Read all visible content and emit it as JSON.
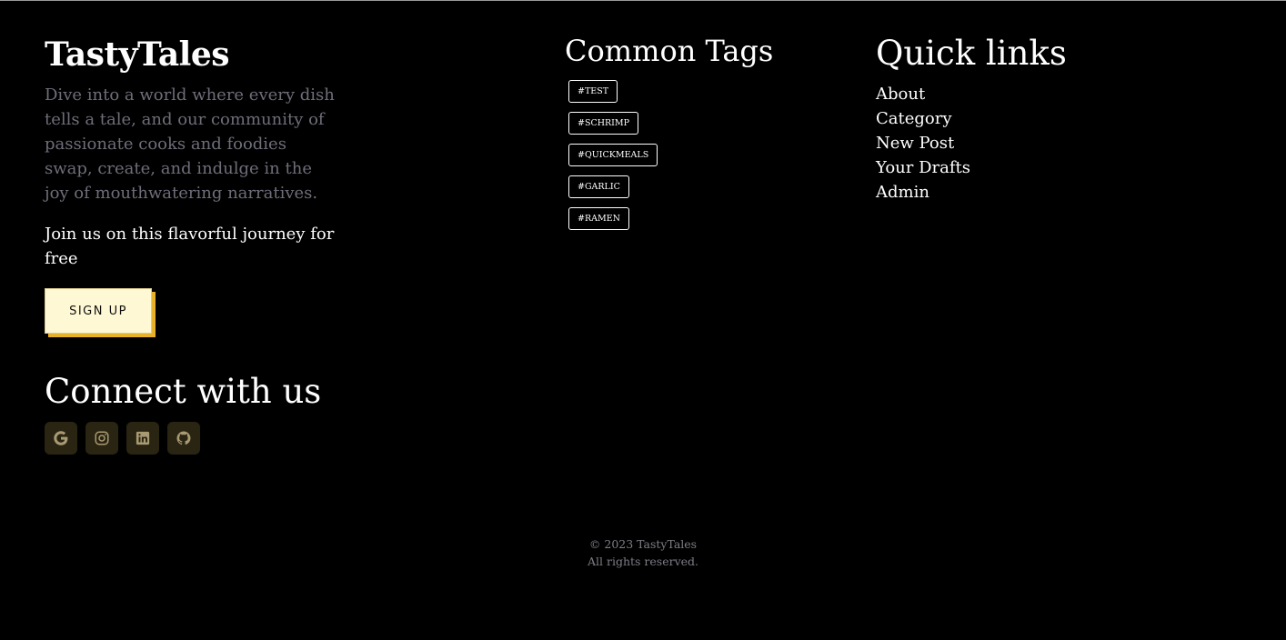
{
  "brand": {
    "name": "TastyTales",
    "tagline": "Dive into a world where every dish tells a tale, and our community of passionate cooks and foodies swap, create, and indulge in the joy of mouthwatering narratives.",
    "join_text": "Join us on this flavorful journey for free",
    "signup_label": "SIGN UP"
  },
  "connect": {
    "title": "Connect with us",
    "icons": [
      "google-icon",
      "instagram-icon",
      "linkedin-icon",
      "github-icon"
    ],
    "icon_color": "#a89a72",
    "icon_bg": "#2a2412"
  },
  "tags": {
    "title": "Common Tags",
    "items": [
      "#TEST",
      "#SCHRIMP",
      "#QUICKMEALS",
      "#GARLIC",
      "#RAMEN"
    ]
  },
  "quick_links": {
    "title": "Quick links",
    "items": [
      "About",
      "Category",
      "New Post",
      "Your Drafts",
      "Admin"
    ]
  },
  "footer": {
    "copyright": "© 2023 TastyTales",
    "rights": "All rights reserved."
  },
  "colors": {
    "background": "#000000",
    "accent": "#e8b12a",
    "button_bg": "#fff8d4",
    "muted_text": "#6e6e7a"
  }
}
